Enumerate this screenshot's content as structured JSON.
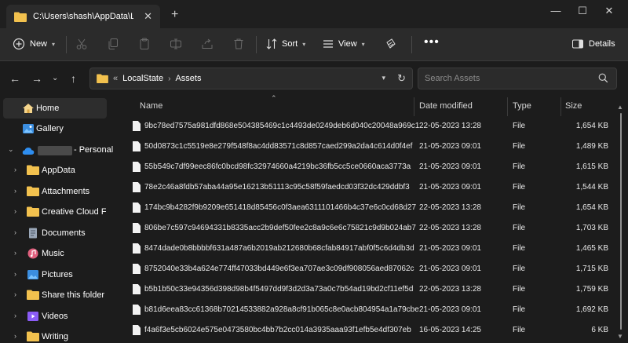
{
  "tab": {
    "title": "C:\\Users\\shash\\AppData\\Local"
  },
  "toolbar": {
    "new_label": "New",
    "sort_label": "Sort",
    "view_label": "View",
    "details_label": "Details"
  },
  "address": {
    "more": "«",
    "crumbs": [
      "LocalState",
      "Assets"
    ]
  },
  "search": {
    "placeholder": "Search Assets"
  },
  "sidebar": {
    "home": "Home",
    "gallery": "Gallery",
    "onedrive_suffix": "- Personal",
    "items": [
      {
        "label": "AppData",
        "icon": "folder-icon"
      },
      {
        "label": "Attachments",
        "icon": "folder-icon"
      },
      {
        "label": "Creative Cloud Files",
        "icon": "folder-icon"
      },
      {
        "label": "Documents",
        "icon": "documents-icon"
      },
      {
        "label": "Music",
        "icon": "music-icon"
      },
      {
        "label": "Pictures",
        "icon": "pictures-icon"
      },
      {
        "label": "Share this folder",
        "icon": "folder-icon"
      },
      {
        "label": "Videos",
        "icon": "videos-icon"
      },
      {
        "label": "Writing",
        "icon": "folder-icon"
      }
    ]
  },
  "columns": {
    "name": "Name",
    "date": "Date modified",
    "type": "Type",
    "size": "Size"
  },
  "files": [
    {
      "name": "9bc78ed7575a981dfd868e504385469c1c4493de0249deb6d040c20048a969c1",
      "date": "22-05-2023 13:28",
      "type": "File",
      "size": "1,654 KB"
    },
    {
      "name": "50d0873c1c5519e8e279f548f8ac4dd83571c8d857caed299a2da4c614d0f4ef",
      "date": "21-05-2023 09:01",
      "type": "File",
      "size": "1,489 KB"
    },
    {
      "name": "55b549c7df99eec86fc0bcd98fc32974660a4219bc36fb5cc5ce0660aca3773a",
      "date": "21-05-2023 09:01",
      "type": "File",
      "size": "1,615 KB"
    },
    {
      "name": "78e2c46a8fdb57aba44a95e16213b51113c95c58f59faedcd03f32dc429ddbf3",
      "date": "21-05-2023 09:01",
      "type": "File",
      "size": "1,544 KB"
    },
    {
      "name": "174bc9b4282f9b9209e651418d85456c0f3aea6311101466b4c37e6c0cd68d27",
      "date": "22-05-2023 13:28",
      "type": "File",
      "size": "1,654 KB"
    },
    {
      "name": "806be7c597c94694331b8335acc2b9def50fee2c8a9c6e6c75821c9d9b024ab7",
      "date": "22-05-2023 13:28",
      "type": "File",
      "size": "1,703 KB"
    },
    {
      "name": "8474dade0b8bbbbf631a487a6b2019ab212680b68cfab84917abf0f5c6d4db3d",
      "date": "21-05-2023 09:01",
      "type": "File",
      "size": "1,465 KB"
    },
    {
      "name": "8752040e33b4a624e774ff47033bd449e6f3ea707ae3c09df908056aed87062c",
      "date": "21-05-2023 09:01",
      "type": "File",
      "size": "1,715 KB"
    },
    {
      "name": "b5b1b50c33e94356d398d98b4f5497dd9f3d2d3a73a0c7b54ad19bd2cf11ef5d",
      "date": "22-05-2023 13:28",
      "type": "File",
      "size": "1,759 KB"
    },
    {
      "name": "b81d6eea83cc61368b70214533882a928a8cf91b065c8e0acb804954a1a79cbe",
      "date": "21-05-2023 09:01",
      "type": "File",
      "size": "1,692 KB"
    },
    {
      "name": "f4a6f3e5cb6024e575e0473580bc4bb7b2cc014a3935aaa93f1efb5e4df307eb",
      "date": "16-05-2023 14:25",
      "type": "File",
      "size": "6 KB"
    }
  ]
}
